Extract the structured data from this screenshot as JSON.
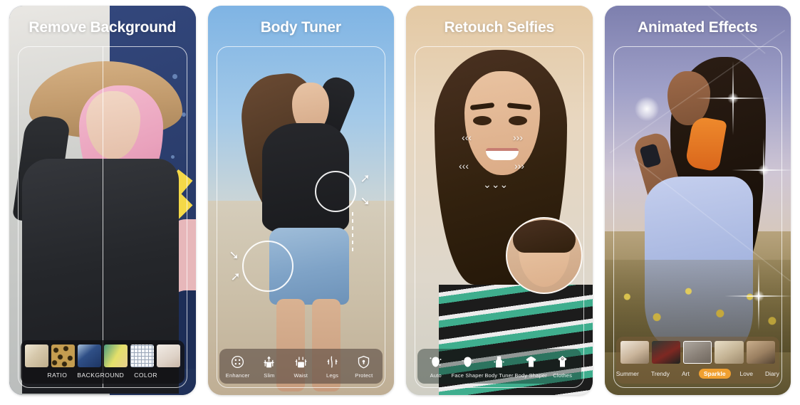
{
  "gallery": {
    "type": "app-store-screenshot-gallery",
    "panel_count": 4
  },
  "panels": [
    {
      "id": "remove-background",
      "title": "Remove Background",
      "header_color": "#3c5288",
      "toolbar": {
        "style": "thumbnails-with-labels",
        "thumbnails": [
          {
            "name": "collage-beige",
            "color": "#d9cdb6"
          },
          {
            "name": "leopard-print",
            "color": "#a8893f"
          },
          {
            "name": "blue-abstract",
            "color": "#2f4f86"
          },
          {
            "name": "yellow-green-art",
            "color": "#c8c447"
          },
          {
            "name": "white-grid",
            "color": "#f0f1f4"
          },
          {
            "name": "pale-neutral",
            "color": "#e2dad2"
          }
        ],
        "labels": [
          "RATIO",
          "BACKGROUND",
          "COLOR"
        ],
        "active_label": "BACKGROUND"
      }
    },
    {
      "id": "body-tuner",
      "title": "Body Tuner",
      "header_color": "#7fb4e4",
      "toolbar": {
        "style": "icon-tools",
        "tools": [
          {
            "label": "Enhancer",
            "icon": "enhancer-icon"
          },
          {
            "label": "Slim",
            "icon": "slim-icon"
          },
          {
            "label": "Waist",
            "icon": "waist-icon"
          },
          {
            "label": "Legs",
            "icon": "legs-icon"
          },
          {
            "label": "Protect",
            "icon": "protect-shield-icon"
          }
        ]
      },
      "overlays": {
        "adjust_circles": 2,
        "arrows": 4,
        "dashed_guide": true
      }
    },
    {
      "id": "retouch-selfies",
      "title": "Retouch Selfies",
      "header_color": "#d9a468",
      "toolbar": {
        "style": "icon-tools",
        "tools": [
          {
            "label": "Auto",
            "icon": "auto-face-icon"
          },
          {
            "label": "Face Shaper",
            "icon": "face-shaper-icon"
          },
          {
            "label": "Body Tuner",
            "icon": "body-tuner-icon"
          },
          {
            "label": "Body Shaper",
            "icon": "body-shaper-icon"
          },
          {
            "label": "Clothes",
            "icon": "clothes-icon"
          }
        ]
      },
      "overlays": {
        "preview_bubble": true,
        "dashed_retouch_arrows": true
      }
    },
    {
      "id": "animated-effects",
      "title": "Animated Effects",
      "header_color": "#7d7fae",
      "toolbar": {
        "style": "thumbnails-with-tabs",
        "thumbnails": [
          {
            "name": "effect-bride",
            "color": "#c8b7a4",
            "selected": false
          },
          {
            "name": "effect-red-flower",
            "color": "#6a2a2a",
            "selected": false
          },
          {
            "name": "effect-sparkle",
            "color": "#8d8d8d",
            "selected": true
          },
          {
            "name": "effect-window-light",
            "color": "#c2b49a",
            "selected": false
          },
          {
            "name": "effect-portrait",
            "color": "#a08c72",
            "selected": false
          }
        ],
        "tabs": [
          "Summer",
          "Trendy",
          "Art",
          "Sparkle",
          "Love",
          "Diary"
        ],
        "active_tab": "Sparkle",
        "active_tab_color": "#f0a030"
      }
    }
  ]
}
